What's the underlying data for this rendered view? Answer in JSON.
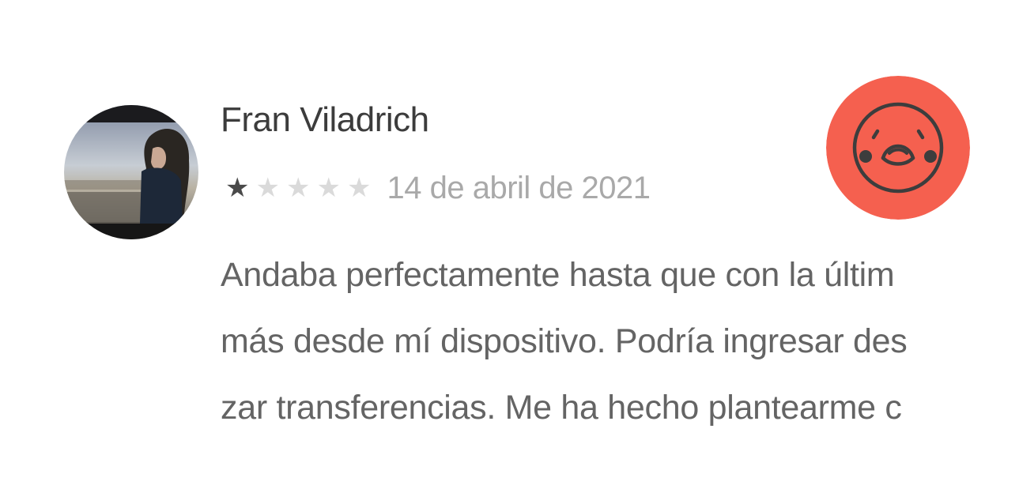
{
  "review": {
    "author": "Fran Viladrich",
    "rating": 1,
    "max_rating": 5,
    "date": "14 de abril de 2021",
    "text_lines": [
      "Andaba perfectamente hasta que con la últim",
      "más desde mí dispositivo. Podría ingresar des",
      "zar transferencias. Me ha hecho plantearme c"
    ],
    "avatar": {
      "icon": "user-photo-avatar"
    },
    "sentiment": {
      "icon": "angry-face-icon",
      "color": "#f5604f"
    }
  },
  "colors": {
    "star_filled": "#4a4a4a",
    "star_empty": "#dadada",
    "date": "#a9a9a9",
    "name": "#3c3c3c",
    "body_text": "#646464",
    "face_stroke": "#3d3d3d"
  }
}
